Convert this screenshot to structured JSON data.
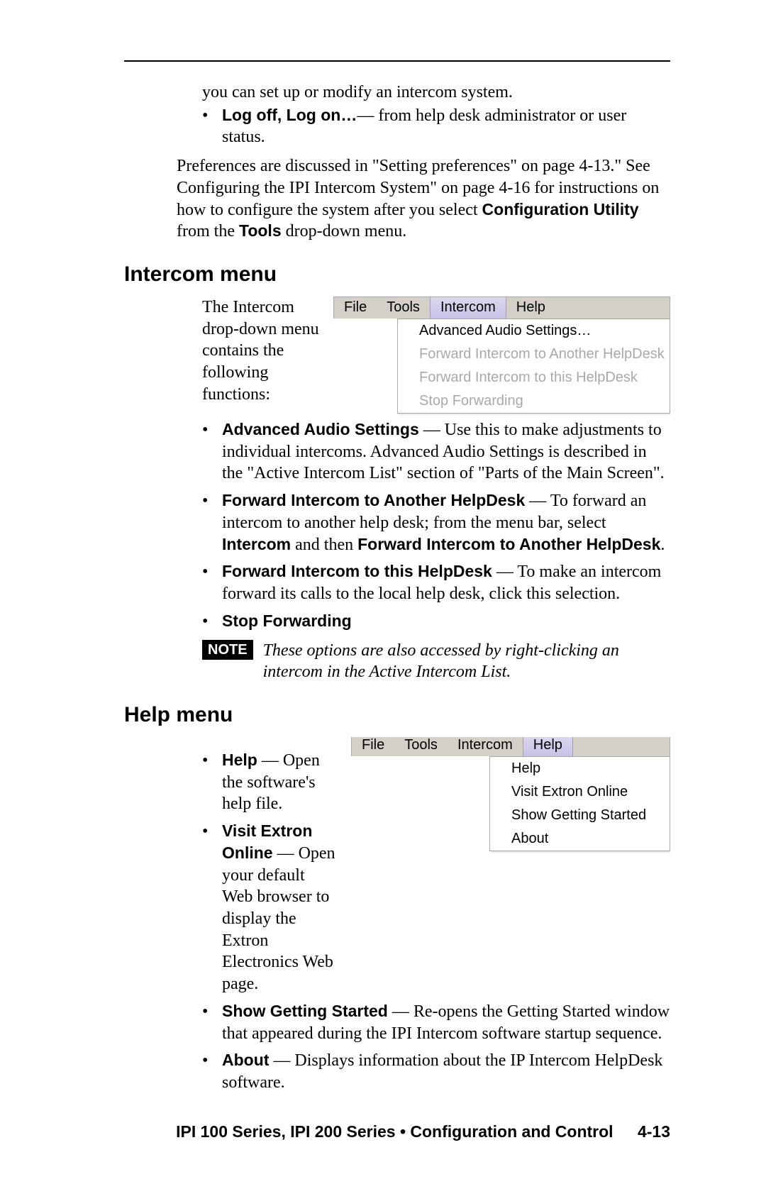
{
  "intro": {
    "line1": "you can set up or modify an intercom system.",
    "bullet_label": "Log off, Log on…",
    "bullet_rest": "— from  help desk administrator or user status.",
    "prefs_para_a": "Preferences are discussed in \"Setting preferences\" on page 4-13.\"  See Configuring the IPI Intercom System\" on page 4-16 for instructions on how to configure the system after you select ",
    "prefs_bold1": "Configuration Utility",
    "prefs_mid": " from the ",
    "prefs_bold2": "Tools",
    "prefs_end": " drop-down menu."
  },
  "intercom": {
    "heading": "Intercom menu",
    "lead": "The Intercom drop-down menu contains the following functions:",
    "menu": {
      "bar": [
        "File",
        "Tools",
        "Intercom",
        "Help"
      ],
      "selected": "Intercom",
      "items": [
        {
          "label": "Advanced Audio Settings…",
          "enabled": true
        },
        {
          "label": "Forward Intercom to Another HelpDesk",
          "enabled": false
        },
        {
          "label": "Forward Intercom to this HelpDesk",
          "enabled": false
        },
        {
          "label": "Stop Forwarding",
          "enabled": false
        }
      ]
    },
    "b1_label": "Advanced Audio Settings",
    "b1_rest": " — Use this to make adjustments to individual intercoms.  Advanced Audio Settings is described in the \"Active Intercom List\" section of  \"Parts of the Main Screen\".",
    "b2_label": "Forward Intercom to Another HelpDesk",
    "b2_rest_a": " — To forward an intercom to another help desk; from the menu bar, select ",
    "b2_bold_a": "Intercom",
    "b2_mid": " and then ",
    "b2_bold_b": "Forward Intercom to Another HelpDesk",
    "b2_end": ".",
    "b3_label": "Forward Intercom to this HelpDesk",
    "b3_rest": " — To make an intercom forward its calls to the local help desk, click this selection.",
    "b4_label": "Stop Forwarding",
    "note_badge": "NOTE",
    "note_text": "These options are also accessed by right-clicking an intercom in the Active Intercom List."
  },
  "help": {
    "heading": "Help menu",
    "menu": {
      "bar": [
        "File",
        "Tools",
        "Intercom",
        "Help"
      ],
      "selected": "Help",
      "items": [
        {
          "label": "Help"
        },
        {
          "label": "Visit Extron Online"
        },
        {
          "label": "Show Getting Started"
        },
        {
          "label": "About"
        }
      ]
    },
    "b1_label": "Help",
    "b1_rest": " — Open the software's help file.",
    "b2_label": "Visit Extron Online",
    "b2_rest": " —  Open your default Web browser to display the Extron Electronics Web page.",
    "b3_label": "Show Getting Started",
    "b3_rest": " — Re-opens the Getting Started window that appeared during the IPI Intercom software startup sequence.",
    "b4_label": "About",
    "b4_rest": " — Displays information about the IP Intercom HelpDesk software."
  },
  "footer": {
    "text": "IPI 100 Series, IPI 200 Series • Configuration and Control",
    "page": "4-13"
  }
}
